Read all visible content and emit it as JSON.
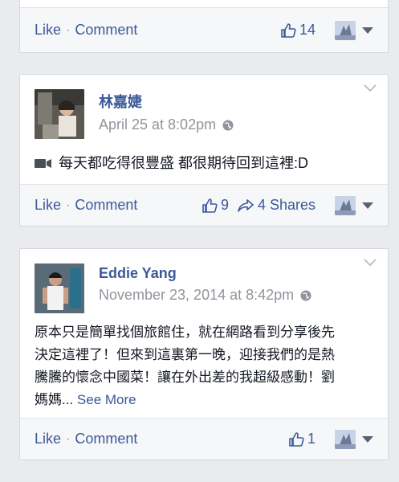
{
  "colors": {
    "background": "#e9ebee",
    "card": "#ffffff",
    "footer": "#f6f7f9",
    "link": "#3b5998",
    "meta": "#90949c",
    "text": "#141823"
  },
  "posts": [
    {
      "actions": {
        "like_label": "Like",
        "separator": "·",
        "comment_label": "Comment"
      },
      "likes": "14",
      "shares": null
    },
    {
      "author": "林嘉婕",
      "timestamp": "April 25 at 8:02pm",
      "privacy_icon": "globe-icon",
      "attachment_icon": "video-camera-icon",
      "body": "每天都吃得很豐盛 都很期待回到這裡:D",
      "actions": {
        "like_label": "Like",
        "separator": "·",
        "comment_label": "Comment"
      },
      "likes": "9",
      "shares": "4 Shares"
    },
    {
      "author": "Eddie Yang",
      "timestamp": "November 23, 2014 at 8:42pm",
      "privacy_icon": "globe-icon",
      "body_lines": [
        "原本只是簡單找個旅館住，就在網路看到分享後先",
        "決定這裡了！但來到這裏第一晚，迎接我們的是熱",
        "騰騰的懷念中國菜！讓在外出差的我超級感動！劉"
      ],
      "body_last": "媽媽...",
      "see_more": "See More",
      "actions": {
        "like_label": "Like",
        "separator": "·",
        "comment_label": "Comment"
      },
      "likes": "1",
      "shares": null
    }
  ]
}
